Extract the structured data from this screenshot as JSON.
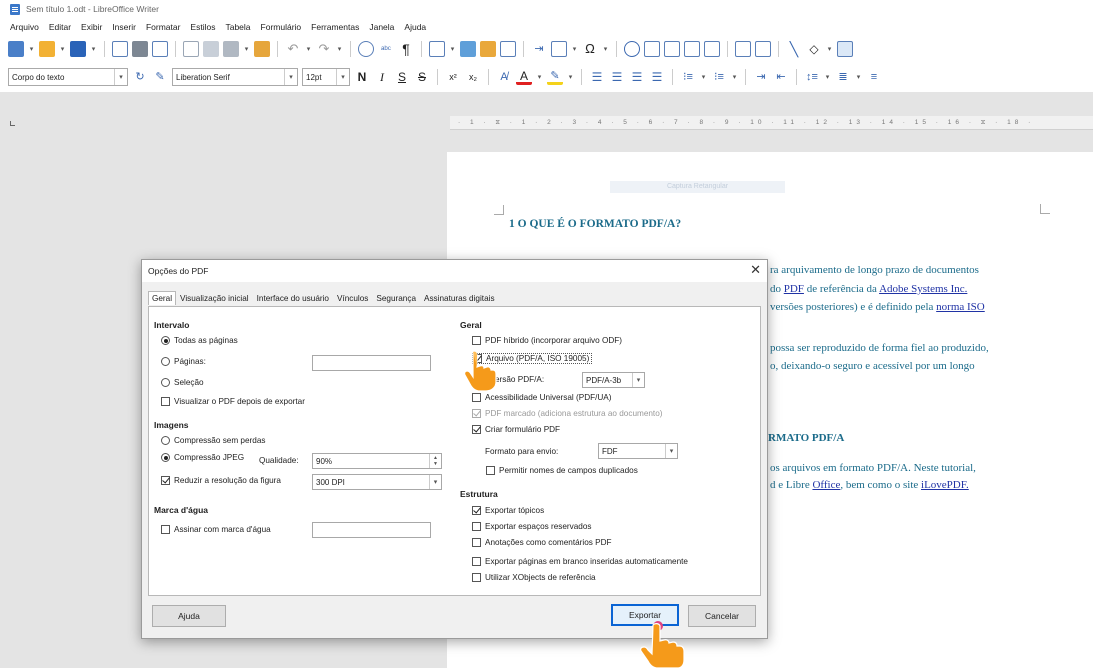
{
  "window": {
    "title": "Sem título 1.odt - LibreOffice Writer"
  },
  "menu": [
    "Arquivo",
    "Editar",
    "Exibir",
    "Inserir",
    "Formatar",
    "Estilos",
    "Tabela",
    "Formulário",
    "Ferramentas",
    "Janela",
    "Ajuda"
  ],
  "format_bar": {
    "paragraph_style": "Corpo do texto",
    "font_name": "Liberation Serif",
    "font_size": "12pt",
    "bold": "N",
    "italic": "I",
    "underline": "S",
    "strike": "S"
  },
  "ruler": {
    "ticks": "· 1 · ⧖ · 1 · 2 · 3 · 4 · 5 · 6 · 7 · 8 · 9 · 10 · 11 · 12 · 13 · 14 · 15 · 16 · ⧖ · 18 ·"
  },
  "document": {
    "caption": "Captura Retangular",
    "heading": "1 O QUE É O FORMATO PDF/A?",
    "lines": [
      {
        "pre": "ra arquivamento de longo prazo de documentos"
      },
      {
        "pre": "do ",
        "link": "PDF",
        "mid": " de referência da ",
        "link2": "Adobe Systems Inc."
      },
      {
        "pre": "versões posteriores) e é definido pela ",
        "link": "norma ISO"
      },
      {
        "pre": " possa ser reproduzido de forma fiel ao produzido,"
      },
      {
        "pre": "o, deixando-o seguro e acessível por um longo"
      },
      {
        "pre": "RMATO PDF/A"
      },
      {
        "pre": " os arquivos em formato PDF/A. Neste tutorial,"
      },
      {
        "pre": "d e Libre ",
        "link": "Office",
        "mid": ", bem como o site ",
        "link2": "iLovePDF."
      }
    ]
  },
  "dialog": {
    "title": "Opções do PDF",
    "tabs": [
      "Geral",
      "Visualização inicial",
      "Interface do usuário",
      "Vínculos",
      "Segurança",
      "Assinaturas digitais"
    ],
    "intervalo": {
      "title": "Intervalo",
      "all_pages": "Todas as páginas",
      "pages": "Páginas:",
      "selection": "Seleção",
      "view_after": "Visualizar o PDF depois de exportar"
    },
    "imagens": {
      "title": "Imagens",
      "lossless": "Compressão sem perdas",
      "jpeg": "Compressão JPEG",
      "quality_label": "Qualidade:",
      "quality_value": "90%",
      "reduce": "Reduzir a resolução da figura",
      "dpi": "300 DPI"
    },
    "watermark": {
      "title": "Marca d'água",
      "sign": "Assinar com marca d'água"
    },
    "geral": {
      "title": "Geral",
      "hybrid": "PDF híbrido (incorporar arquivo ODF)",
      "archive": "Arquivo (PDF/A, ISO 19005)",
      "version_label": "Versão PDF/A:",
      "version_value": "PDF/A-3b",
      "universal": "Acessibilidade Universal (PDF/UA)",
      "tagged": "PDF marcado (adiciona estrutura ao documento)",
      "form": "Criar formulário PDF",
      "submit_label": "Formato para envio:",
      "submit_value": "FDF",
      "dup_names": "Permitir nomes de campos duplicados"
    },
    "estrutura": {
      "title": "Estrutura",
      "bookmarks": "Exportar tópicos",
      "placeholders": "Exportar espaços reservados",
      "comments": "Anotações como comentários PDF",
      "blank_pages": "Exportar páginas em branco inseridas automaticamente",
      "xobjects": "Utilizar XObjects de referência"
    },
    "buttons": {
      "help": "Ajuda",
      "export": "Exportar",
      "cancel": "Cancelar"
    }
  },
  "colors": {
    "doc_text": "#1b6b8a",
    "link": "#2033a5",
    "focus": "#0a64d4",
    "hand": "#f59a1a"
  }
}
